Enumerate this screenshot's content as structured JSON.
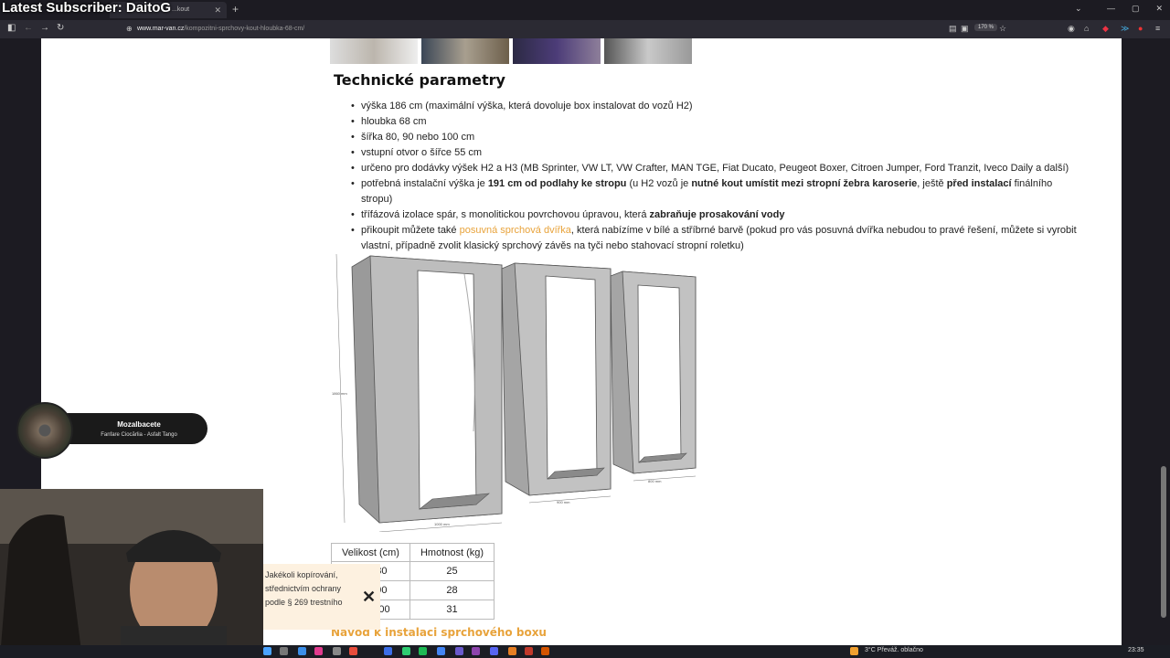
{
  "overlay": {
    "stream_title": "Latest Subscriber: DaitoG",
    "music_title": "Mozalbacete",
    "music_subtitle": "Fanfare Ciocărlia - Asfalt Tango",
    "notice_lines": [
      "Jakékoli kopírování,",
      "střednictvím ochrany",
      "podle § 269 trestního"
    ]
  },
  "browser": {
    "tab_title": "...kout",
    "url_domain": "www.mar-van.cz",
    "url_path": "/kompozitni-sprchovy-kout-hloubka-68-cm/",
    "zoom": "170 %"
  },
  "page": {
    "section_title": "Technické parametry",
    "params": [
      {
        "parts": [
          {
            "t": "výška 186 cm (maximální výška, která dovoluje box instalovat do vozů H2)"
          }
        ]
      },
      {
        "parts": [
          {
            "t": "hloubka 68 cm"
          }
        ]
      },
      {
        "parts": [
          {
            "t": "šířka 80, 90 nebo 100 cm"
          }
        ]
      },
      {
        "parts": [
          {
            "t": "vstupní otvor o šířce 55 cm"
          }
        ]
      },
      {
        "parts": [
          {
            "t": "určeno pro dodávky výšek H2 a H3 (MB Sprinter, VW LT, VW Crafter, MAN TGE, Fiat Ducato, Peugeot Boxer, Citroen Jumper, Ford Tranzit, Iveco Daily a další)"
          }
        ]
      },
      {
        "parts": [
          {
            "t": "potřebná instalační výška je "
          },
          {
            "t": "191 cm od podlahy ke stropu",
            "b": true
          },
          {
            "t": " (u H2 vozů je "
          },
          {
            "t": "nutné kout umístit mezi stropní žebra karoserie",
            "b": true
          },
          {
            "t": ", ještě "
          },
          {
            "t": "před instalací",
            "b": true
          },
          {
            "t": " finálního stropu)"
          }
        ]
      },
      {
        "parts": [
          {
            "t": "třífázová izolace spár, s monolitickou povrchovou úpravou, která "
          },
          {
            "t": "zabraňuje prosakování vody",
            "b": true
          }
        ]
      },
      {
        "parts": [
          {
            "t": "přikoupit můžete také "
          },
          {
            "t": "posuvná sprchová dvířka",
            "link": true
          },
          {
            "t": ", která nabízíme v bílé a stříbrné barvě (pokud pro vás posuvná dvířka nebudou to pravé řešení, můžete si vyrobit vlastní, případně zvolit klasický sprchový závěs na tyči nebo stahovací stropní roletku)"
          }
        ]
      }
    ],
    "diagram_labels": {
      "height": "1860 mm",
      "w1000": "1000 mm",
      "w900": "900 mm",
      "w800": "800 mm"
    },
    "table": {
      "headers": [
        "Velikost (cm)",
        "Hmotnost (kg)"
      ],
      "rows": [
        [
          "68 x 80",
          "25"
        ],
        [
          "68 x 90",
          "28"
        ],
        [
          "68 x 100",
          "31"
        ]
      ]
    },
    "guide_link": "Návod k instalaci sprchového boxu"
  },
  "taskbar": {
    "weather": "3°C  Převáž. oblačno",
    "time": "23:35"
  }
}
